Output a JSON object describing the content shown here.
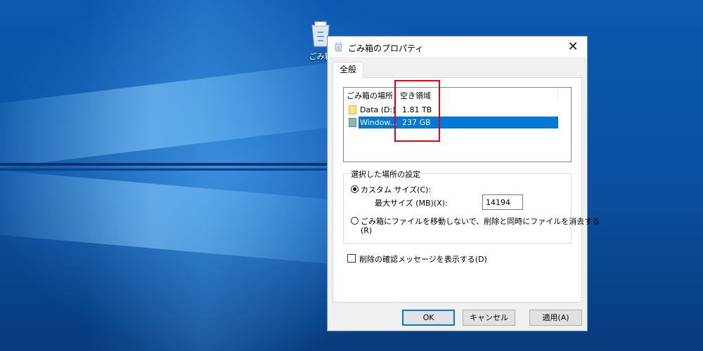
{
  "desktop": {
    "icon_label": "ごみ箱",
    "icon_name": "recycle-bin-icon"
  },
  "dialog": {
    "title": "ごみ箱のプロパティ",
    "close_glyph": "✕",
    "tab_label": "全般",
    "list": {
      "columns": [
        "ごみ箱の場所",
        "空き領域"
      ],
      "rows": [
        {
          "name": "Data (D:)",
          "space": "1.81 TB",
          "icon": "drive-icon",
          "selected": false
        },
        {
          "name": "Window...",
          "space": "237 GB",
          "icon": "system-drive-icon",
          "selected": true
        }
      ]
    },
    "group": {
      "title": "選択した場所の設定",
      "custom_size_label": "カスタム サイズ(C):",
      "max_size_label": "最大サイズ (MB)(X):",
      "max_size_value": "14194",
      "no_recycle_label_line1": "ごみ箱にファイルを移動しないで、削除と同時にファイルを消去する",
      "no_recycle_label_line2": "(R)",
      "selected_option": "custom"
    },
    "confirm_delete_label": "削除の確認メッセージを表示する(D)",
    "confirm_delete_checked": false,
    "buttons": {
      "ok": "OK",
      "cancel": "キャンセル",
      "apply": "適用(A)"
    }
  },
  "colors": {
    "selection": "#0078d7",
    "highlight_box": "#e60012",
    "wallpaper": "#0a4f9c"
  }
}
